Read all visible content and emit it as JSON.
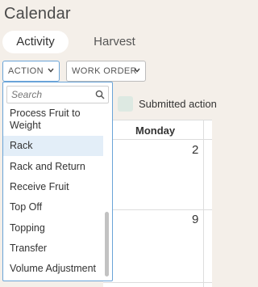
{
  "page": {
    "title": "Calendar"
  },
  "tabs": [
    {
      "label": "Activity",
      "active": true
    },
    {
      "label": "Harvest",
      "active": false
    }
  ],
  "filters": {
    "action": {
      "label": "ACTION"
    },
    "work_order": {
      "label": "WORK ORDER"
    }
  },
  "legend": {
    "label": "Submitted action",
    "color": "#dde9e2"
  },
  "calendar": {
    "day_header": "Monday",
    "dates": [
      "2",
      "9"
    ]
  },
  "dropdown": {
    "search_placeholder": "Search",
    "options": [
      "Process Fruit to Weight",
      "Rack",
      "Rack and Return",
      "Receive Fruit",
      "Top Off",
      "Topping",
      "Transfer",
      "Volume Adjustment"
    ],
    "highlighted": "Rack"
  },
  "colors": {
    "background": "#f4efe9",
    "focus_border": "#6aa4d8",
    "highlight": "#e3eef8"
  }
}
